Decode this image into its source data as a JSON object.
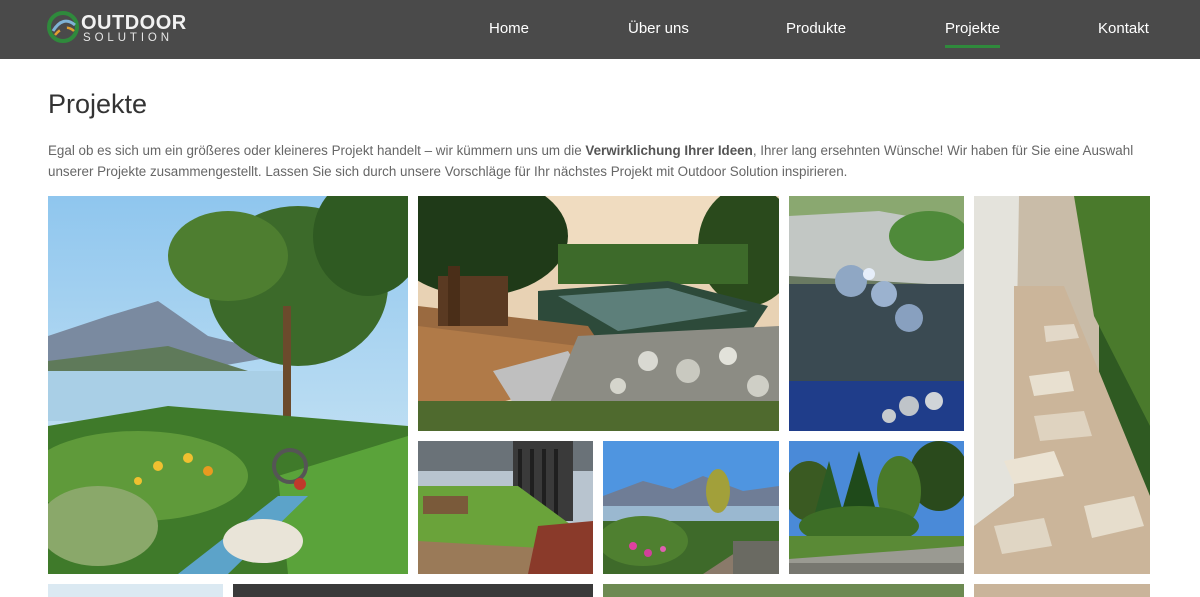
{
  "brand": {
    "name_line1": "OUTDOOR",
    "name_line2": "SOLUTION",
    "colors": {
      "header_bg": "#4a4a4a",
      "accent": "#2f8a3c"
    }
  },
  "nav": {
    "items": [
      {
        "label": "Home"
      },
      {
        "label": "Über uns"
      },
      {
        "label": "Produkte"
      },
      {
        "label": "Projekte",
        "active": true
      },
      {
        "label": "Kontakt"
      }
    ]
  },
  "page": {
    "title": "Projekte",
    "intro_before": "Egal ob es sich um ein größeres oder kleineres Projekt handelt – wir kümmern uns um die ",
    "intro_bold": "Verwirklichung Ihrer Ideen",
    "intro_after": ", Ihrer lang ersehnten Wünsche! Wir haben für Sie eine Auswahl unserer Projekte zusammengestellt. Lassen Sie sich durch unsere Vorschläge für Ihr nächstes Projekt mit Outdoor Solution inspirieren."
  },
  "gallery": {
    "images": [
      {
        "subject": "garden-lake-view-photo"
      },
      {
        "subject": "natural-pond-deck-photo"
      },
      {
        "subject": "water-feature-spheres-photo"
      },
      {
        "subject": "gravel-stepping-stone-path-photo"
      },
      {
        "subject": "lawn-installation-photo"
      },
      {
        "subject": "lake-mountain-garden-photo"
      },
      {
        "subject": "conifer-garden-photo"
      }
    ]
  }
}
